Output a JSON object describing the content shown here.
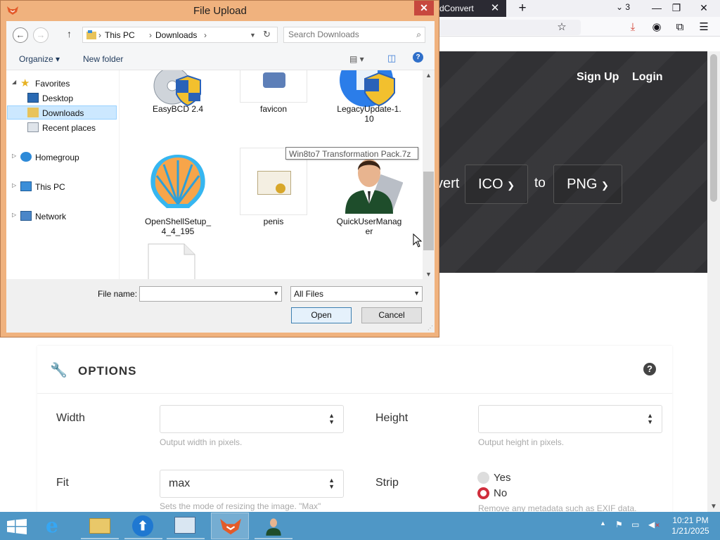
{
  "browser": {
    "active_tab_title": "dConvert",
    "tab_close": "✕",
    "new_tab": "+",
    "tab_count": "3",
    "window_controls": [
      "minimize",
      "restore",
      "close"
    ]
  },
  "site": {
    "sign_up": "Sign Up",
    "login": "Login",
    "convert_word": "vert",
    "from_format": "ICO",
    "to_word": "to",
    "to_format": "PNG"
  },
  "options": {
    "title": "OPTIONS",
    "width_label": "Width",
    "width_value": "",
    "width_help": "Output width in pixels.",
    "height_label": "Height",
    "height_value": "",
    "height_help": "Output height in pixels.",
    "fit_label": "Fit",
    "fit_value": "max",
    "fit_help": "Sets the mode of resizing the image. \"Max\"",
    "strip_label": "Strip",
    "strip_yes": "Yes",
    "strip_no": "No",
    "strip_selected": "No",
    "strip_help": "Remove any metadata such as EXIF data."
  },
  "dialog": {
    "title": "File Upload",
    "breadcrumb": [
      "This PC",
      "Downloads"
    ],
    "search_placeholder": "Search Downloads",
    "toolbar": {
      "organize": "Organize ▾",
      "new_folder": "New folder"
    },
    "nav": {
      "favorites": "Favorites",
      "desktop": "Desktop",
      "downloads": "Downloads",
      "recent": "Recent places",
      "homegroup": "Homegroup",
      "thispc": "This PC",
      "network": "Network"
    },
    "files": [
      {
        "name": "EasyBCD 2.4",
        "icon": "easybcd-icon"
      },
      {
        "name": "favicon",
        "icon": "favicon-icon"
      },
      {
        "name": "LegacyUpdate-1.\n10",
        "icon": "legacy-update-icon"
      },
      {
        "name": "OpenShellSetup_\n4_4_195",
        "icon": "openshell-icon"
      },
      {
        "name": "penis",
        "icon": "certificate-icon"
      },
      {
        "name": "QuickUserManag\ner",
        "icon": "user-manager-icon"
      },
      {
        "name": "",
        "icon": "blank-file-icon"
      }
    ],
    "tooltip": "Win8to7 Transformation Pack.7z",
    "file_name_label": "File name:",
    "file_name_value": "",
    "file_type": "All Files",
    "open_button": "Open",
    "cancel_button": "Cancel",
    "close_glyph": "✕"
  },
  "taskbar": {
    "time": "10:21 PM",
    "date": "1/21/2025",
    "items": [
      "internet-explorer",
      "file-explorer",
      "app-updater",
      "control-panel",
      "firefox-upload",
      "user-manager"
    ]
  },
  "colors": {
    "dialog_frame": "#f0b27e",
    "taskbar": "#4f97c6",
    "accent_red": "#d02e3c",
    "hero_bg": "#333336"
  }
}
